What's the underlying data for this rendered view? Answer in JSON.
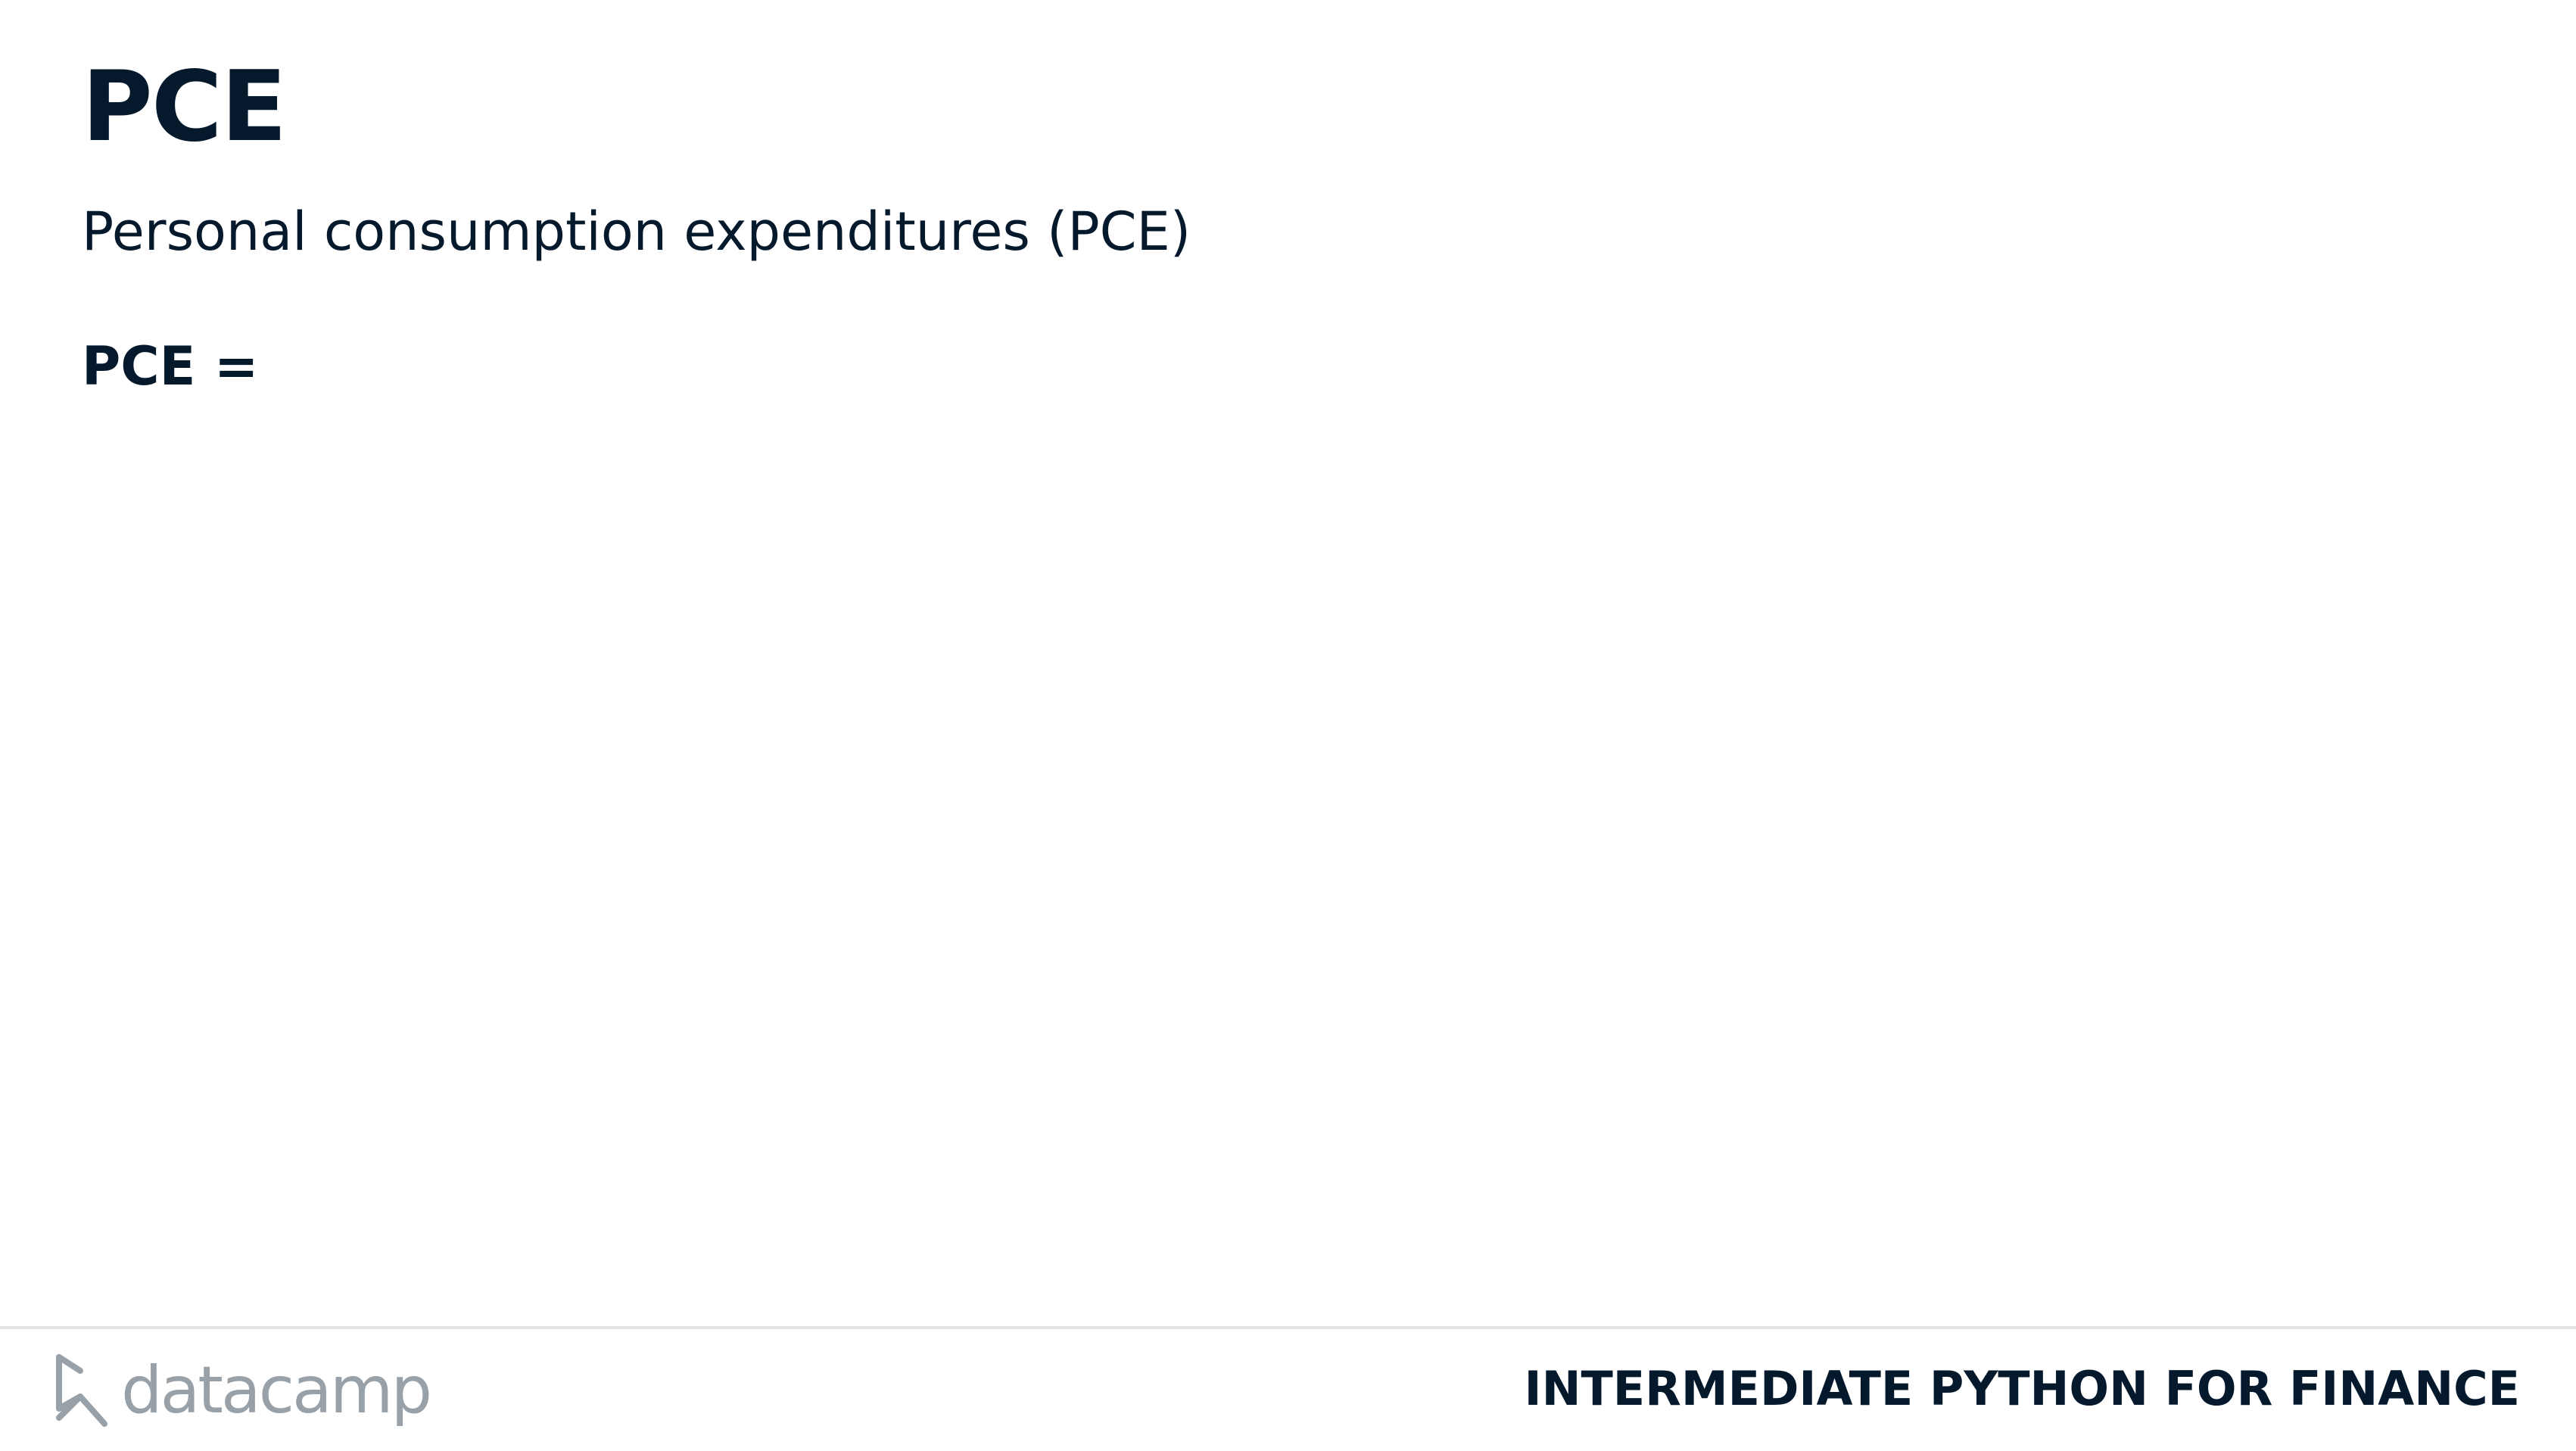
{
  "slide": {
    "title": "PCE",
    "subtitle": "Personal consumption expenditures (PCE)",
    "formula": "PCE ="
  },
  "footer": {
    "logo_text": "datacamp",
    "logo_icon": "datacamp-logo-icon",
    "course_name": "INTERMEDIATE PYTHON FOR FINANCE"
  },
  "colors": {
    "text": "#05192d",
    "logo_gray": "#98a0a8",
    "rule": "#e2e4e6",
    "background": "#ffffff"
  }
}
